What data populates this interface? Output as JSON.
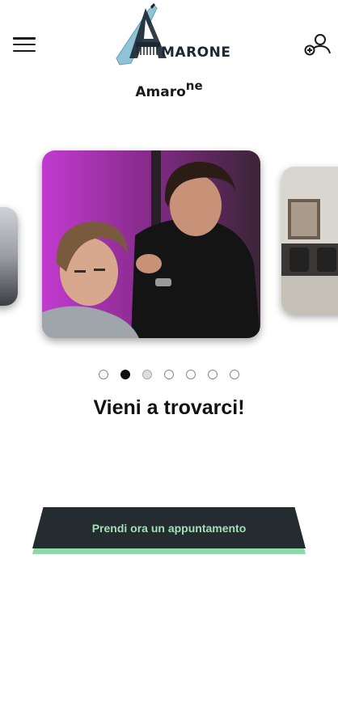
{
  "header": {
    "logo_letter": "A",
    "logo_text": "MARONE",
    "menu_icon": "hamburger-menu-icon",
    "account_icon": "add-user-icon"
  },
  "brand": {
    "title_main": "Amaro",
    "title_sup": "ne"
  },
  "carousel": {
    "slides": [
      "slide-barber-portrait",
      "slide-barber-styling",
      "slide-shop-interior"
    ],
    "active_index": 1,
    "dot_count": 7
  },
  "headline": "Vieni a trovarci!",
  "cta": {
    "label": "Prendi ora un appuntamento"
  },
  "colors": {
    "cta_bg": "#242c30",
    "cta_text": "#9fe0b5",
    "cta_accent": "#8fd8a8",
    "logo_teal": "#7fb6c9",
    "logo_dark": "#1c2833"
  }
}
